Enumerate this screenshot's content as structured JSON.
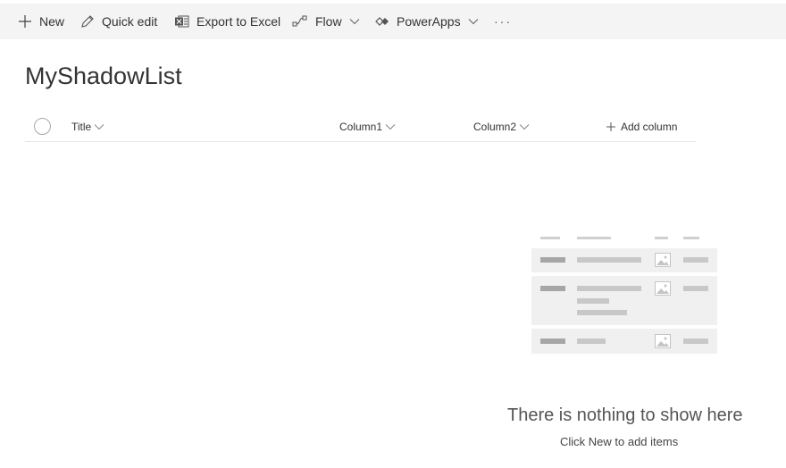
{
  "commandbar": {
    "new_label": "New",
    "quick_edit_label": "Quick edit",
    "export_label": "Export to Excel",
    "flow_label": "Flow",
    "powerapps_label": "PowerApps",
    "more_label": "···"
  },
  "list": {
    "title": "MyShadowList",
    "columns": [
      {
        "label": "Title"
      },
      {
        "label": "Column1"
      },
      {
        "label": "Column2"
      }
    ],
    "add_column_label": "Add column"
  },
  "empty_state": {
    "title": "There is nothing to show here",
    "subtitle": "Click New to add items"
  },
  "icons": {
    "new": "plus-icon",
    "quick_edit": "pencil-icon",
    "export": "excel-icon",
    "flow": "flow-icon",
    "powerapps": "powerapps-icon",
    "chevron": "chevron-down-icon",
    "more": "ellipsis-icon"
  },
  "colors": {
    "commandbar_bg": "#f4f4f4",
    "text": "#333333",
    "illustration_bar": "#c8c8c8",
    "illustration_card": "#f0f0f0"
  }
}
